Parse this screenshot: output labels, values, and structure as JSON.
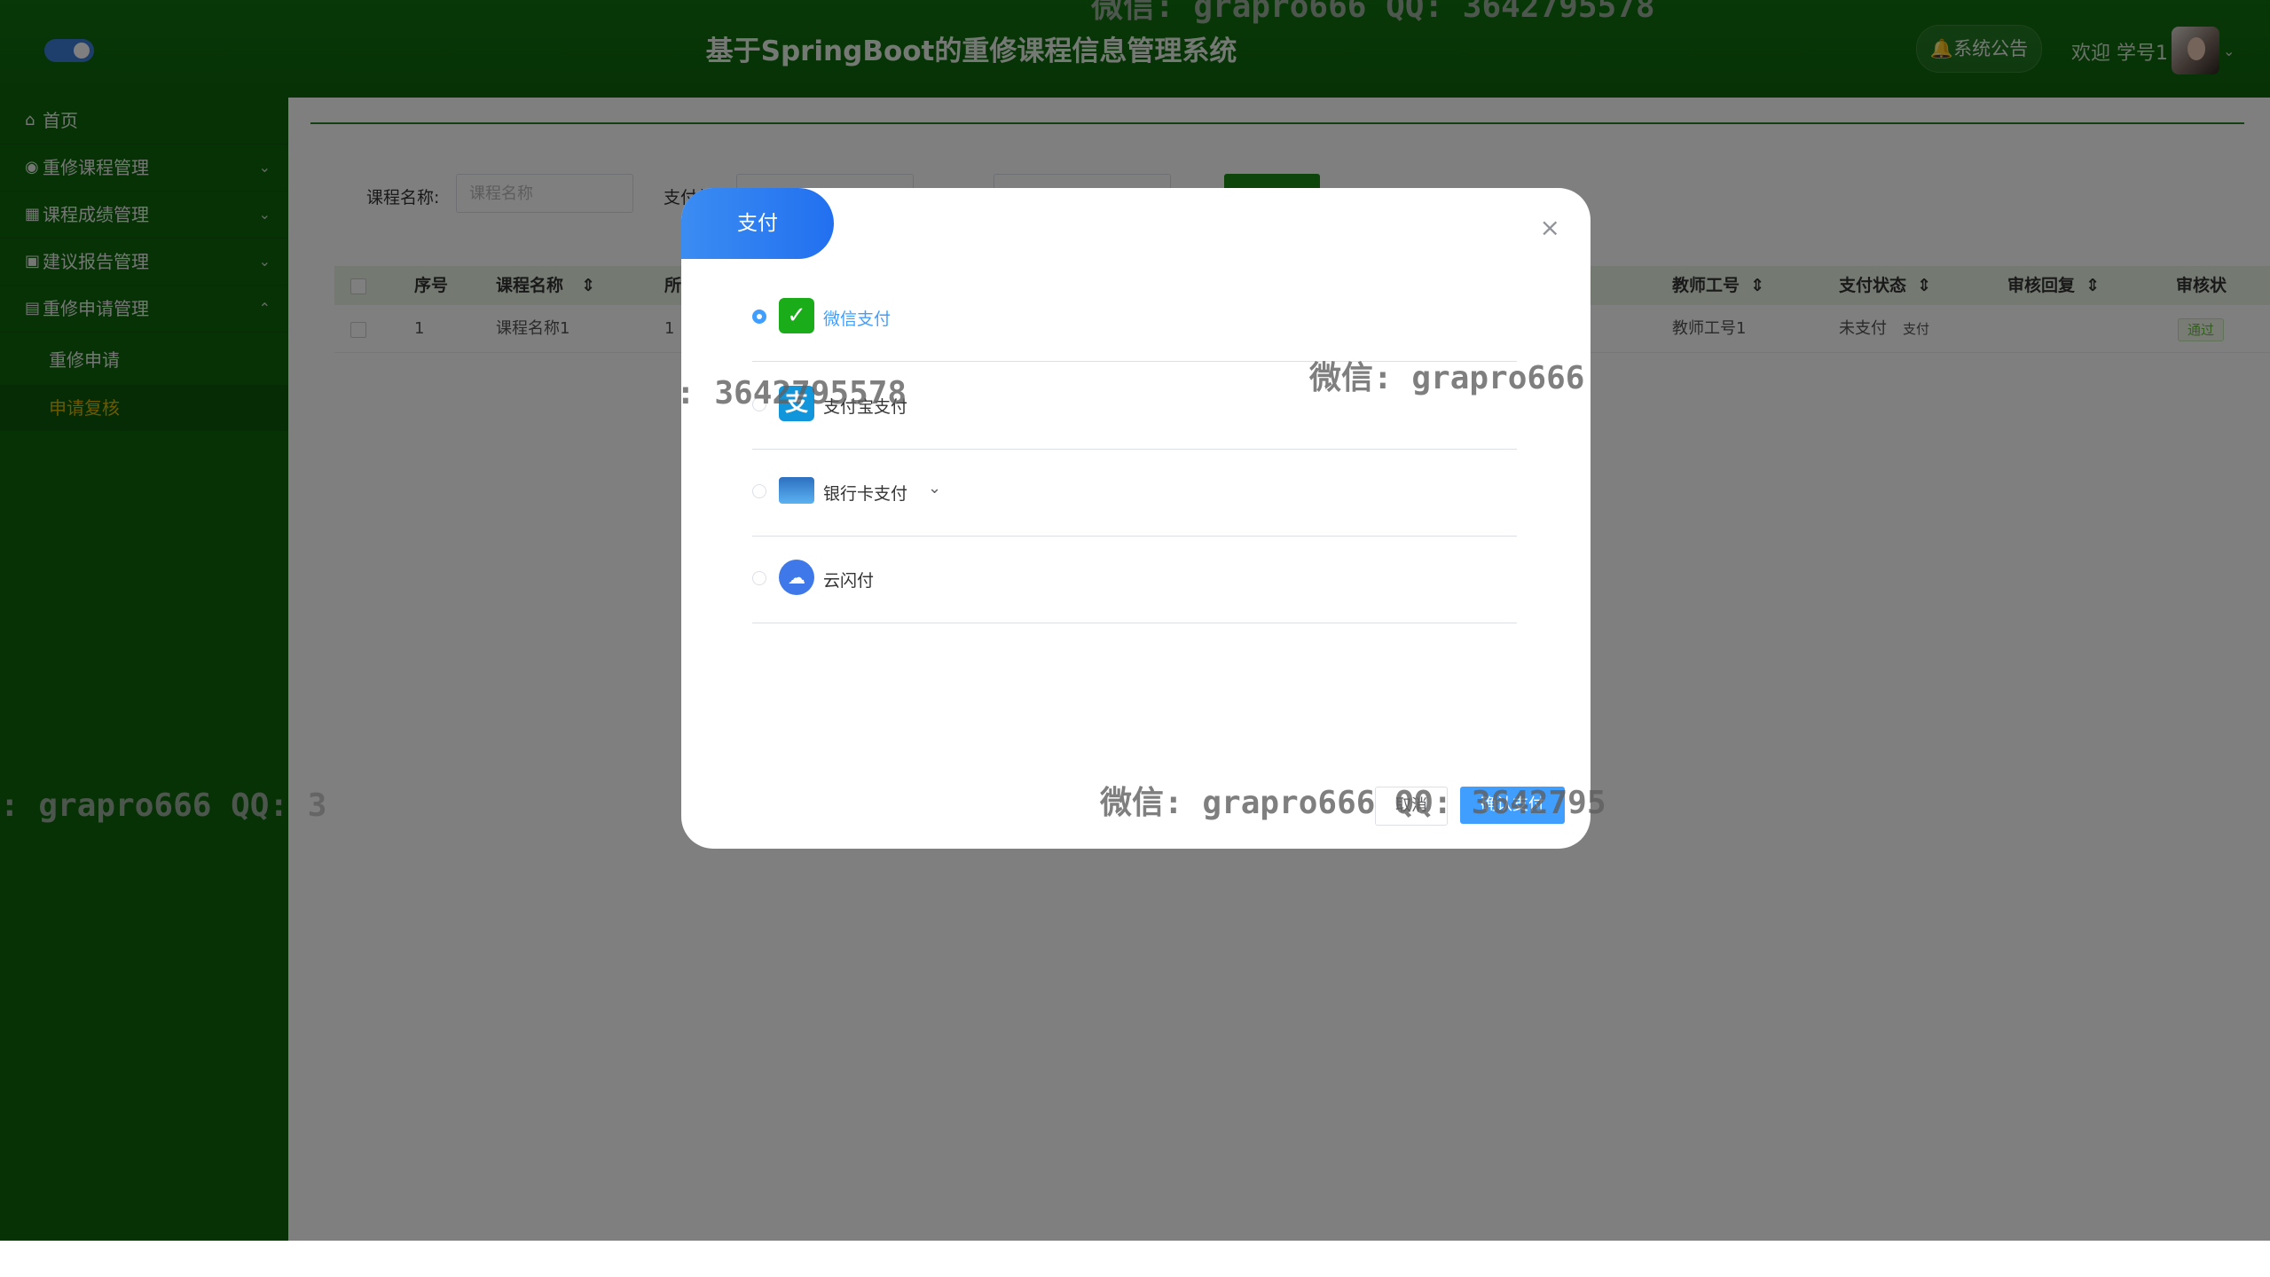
{
  "header": {
    "title": "基于SpringBoot的重修课程信息管理系统",
    "notice_label": "系统公告",
    "welcome": "欢迎 学号1"
  },
  "sidebar": {
    "items": [
      {
        "icon": "home-icon",
        "label": "首页"
      },
      {
        "icon": "course-icon",
        "label": "重修课程管理"
      },
      {
        "icon": "grade-icon",
        "label": "课程成绩管理"
      },
      {
        "icon": "report-icon",
        "label": "建议报告管理"
      },
      {
        "icon": "apply-icon",
        "label": "重修申请管理"
      }
    ],
    "subitems": [
      {
        "label": "重修申请"
      },
      {
        "label": "申请复核"
      }
    ]
  },
  "search": {
    "course_name_label": "课程名称:",
    "course_name_placeholder": "课程名称",
    "pay_status_label": "支付状态"
  },
  "table": {
    "columns": [
      "序号",
      "课程名称",
      "所",
      "教师工号",
      "支付状态",
      "审核回复",
      "审核状"
    ],
    "rows": [
      {
        "index": "1",
        "course_name": "课程名称1",
        "dept": "1",
        "teacher_id": "教师工号1",
        "pay_status": "未支付",
        "pay_action": "支付",
        "review_reply": "",
        "review_status": "通过"
      }
    ]
  },
  "dialog": {
    "tab_label": "支付",
    "options": [
      {
        "icon": "wechat-pay-icon",
        "label": "微信支付",
        "selected": true
      },
      {
        "icon": "alipay-icon",
        "label": "支付宝支付",
        "selected": false
      },
      {
        "icon": "bank-card-icon",
        "label": "银行卡支付",
        "selected": false
      },
      {
        "icon": "unionpay-cloud-icon",
        "label": "云闪付",
        "selected": false
      }
    ],
    "cancel_label": "取消",
    "confirm_label": "确认支付"
  },
  "watermarks": {
    "top": "微信: grapro666 QQ: 3642795578",
    "mid_left": ": 3642795578",
    "mid_right": "微信: grapro666",
    "left": ": grapro666 QQ: 3",
    "bottom": "微信: grapro666 QQ: 3642795"
  },
  "colors": {
    "header_bg": "#11700f",
    "sidebar_bg": "#0e650c",
    "active_sub_text": "#d4b200",
    "primary": "#409eff",
    "dialog_tab": "#2f7ff0"
  }
}
